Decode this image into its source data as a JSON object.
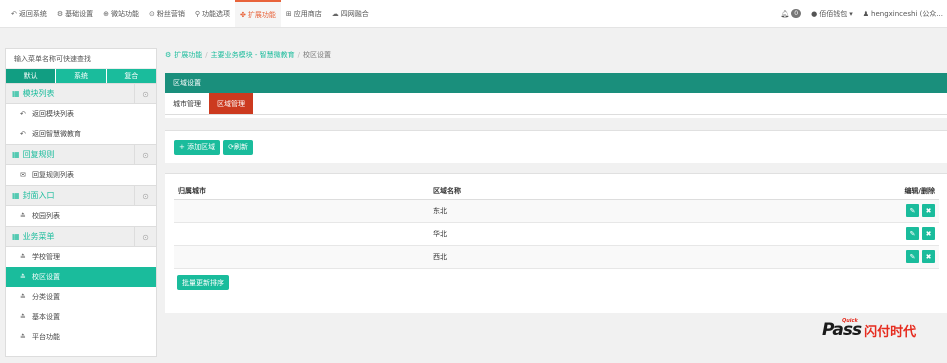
{
  "topnav": [
    {
      "icon": "↶",
      "label": "返回系统"
    },
    {
      "icon": "⚙",
      "label": "基础设置"
    },
    {
      "icon": "⊕",
      "label": "微站功能"
    },
    {
      "icon": "⊙",
      "label": "粉丝营销"
    },
    {
      "icon": "⚲",
      "label": "功能选项"
    },
    {
      "icon": "✤",
      "label": "扩展功能"
    },
    {
      "icon": "⊞",
      "label": "应用商店"
    },
    {
      "icon": "☁",
      "label": "四网融合"
    }
  ],
  "topright": {
    "notify_count": "0",
    "wallet_label": "佰佰钱包",
    "user_label": "hengxinceshi (公众..."
  },
  "sidebar": {
    "search_placeholder": "输入菜单名称可快速查找",
    "tabs": [
      "默认",
      "系统",
      "复合"
    ],
    "groups": [
      {
        "title": "模块列表",
        "items": [
          {
            "icon": "↶",
            "label": "返回模块列表"
          },
          {
            "icon": "↶",
            "label": "返回智慧微教育"
          }
        ]
      },
      {
        "title": "回复规则",
        "items": [
          {
            "icon": "✉",
            "label": "回复规则列表"
          }
        ]
      },
      {
        "title": "封面入口",
        "items": [
          {
            "icon": "≛",
            "label": "校园列表"
          }
        ]
      },
      {
        "title": "业务菜单",
        "items": [
          {
            "icon": "≛",
            "label": "学校管理"
          },
          {
            "icon": "≛",
            "label": "校区设置"
          },
          {
            "icon": "≛",
            "label": "分类设置"
          },
          {
            "icon": "≛",
            "label": "基本设置"
          },
          {
            "icon": "≛",
            "label": "平台功能"
          }
        ]
      }
    ]
  },
  "breadcrumb": {
    "items": [
      "扩展功能",
      "主要业务模块 - 智慧微教育"
    ],
    "current": "校区设置"
  },
  "panel": {
    "title": "区域设置",
    "tabs": [
      "城市管理",
      "区域管理"
    ]
  },
  "toolbar": {
    "add_label": "+ 添加区域",
    "refresh_label": "⟳刷新"
  },
  "table": {
    "headers": [
      "归属城市",
      "区域名称",
      "编辑/删除"
    ],
    "rows": [
      {
        "city": "",
        "name": "东北"
      },
      {
        "city": "",
        "name": "华北"
      },
      {
        "city": "",
        "name": "西北"
      }
    ],
    "sort_label": "批量更新排序"
  },
  "logo": {
    "quick": "Quick",
    "pass": "Pass",
    "cn": "闪付时代"
  }
}
